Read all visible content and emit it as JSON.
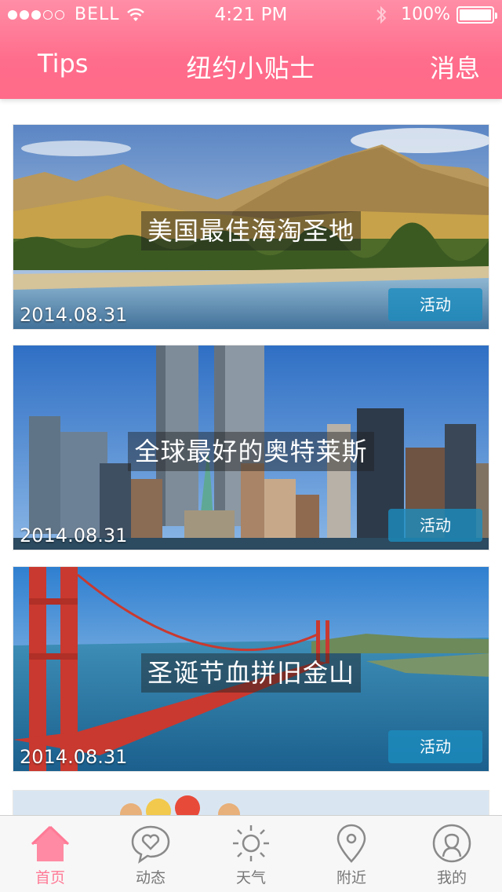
{
  "status_bar": {
    "carrier": "BELL",
    "time": "4:21 PM",
    "battery": "100%"
  },
  "nav": {
    "left": "Tips",
    "title": "纽约小贴士",
    "right": "消息"
  },
  "colors": {
    "brand_pink": "#ff6d8c",
    "tag_blue": "#1c8cbe",
    "tab_active": "#ff7a96",
    "tab_inactive": "#777777"
  },
  "cards": [
    {
      "title": "美国最佳海淘圣地",
      "date": "2014.08.31",
      "tag": "活动",
      "scene": "mountain-lake"
    },
    {
      "title": "全球最好的奥特莱斯",
      "date": "2014.08.31",
      "tag": "活动",
      "scene": "city-skyline"
    },
    {
      "title": "圣诞节血拼旧金山",
      "date": "2014.08.31",
      "tag": "活动",
      "scene": "golden-gate-bridge"
    }
  ],
  "tabs": [
    {
      "label": "首页",
      "icon": "home-icon",
      "active": true
    },
    {
      "label": "动态",
      "icon": "heart-bubble-icon",
      "active": false
    },
    {
      "label": "天气",
      "icon": "sun-icon",
      "active": false
    },
    {
      "label": "附近",
      "icon": "location-pin-icon",
      "active": false
    },
    {
      "label": "我的",
      "icon": "user-icon",
      "active": false
    }
  ]
}
